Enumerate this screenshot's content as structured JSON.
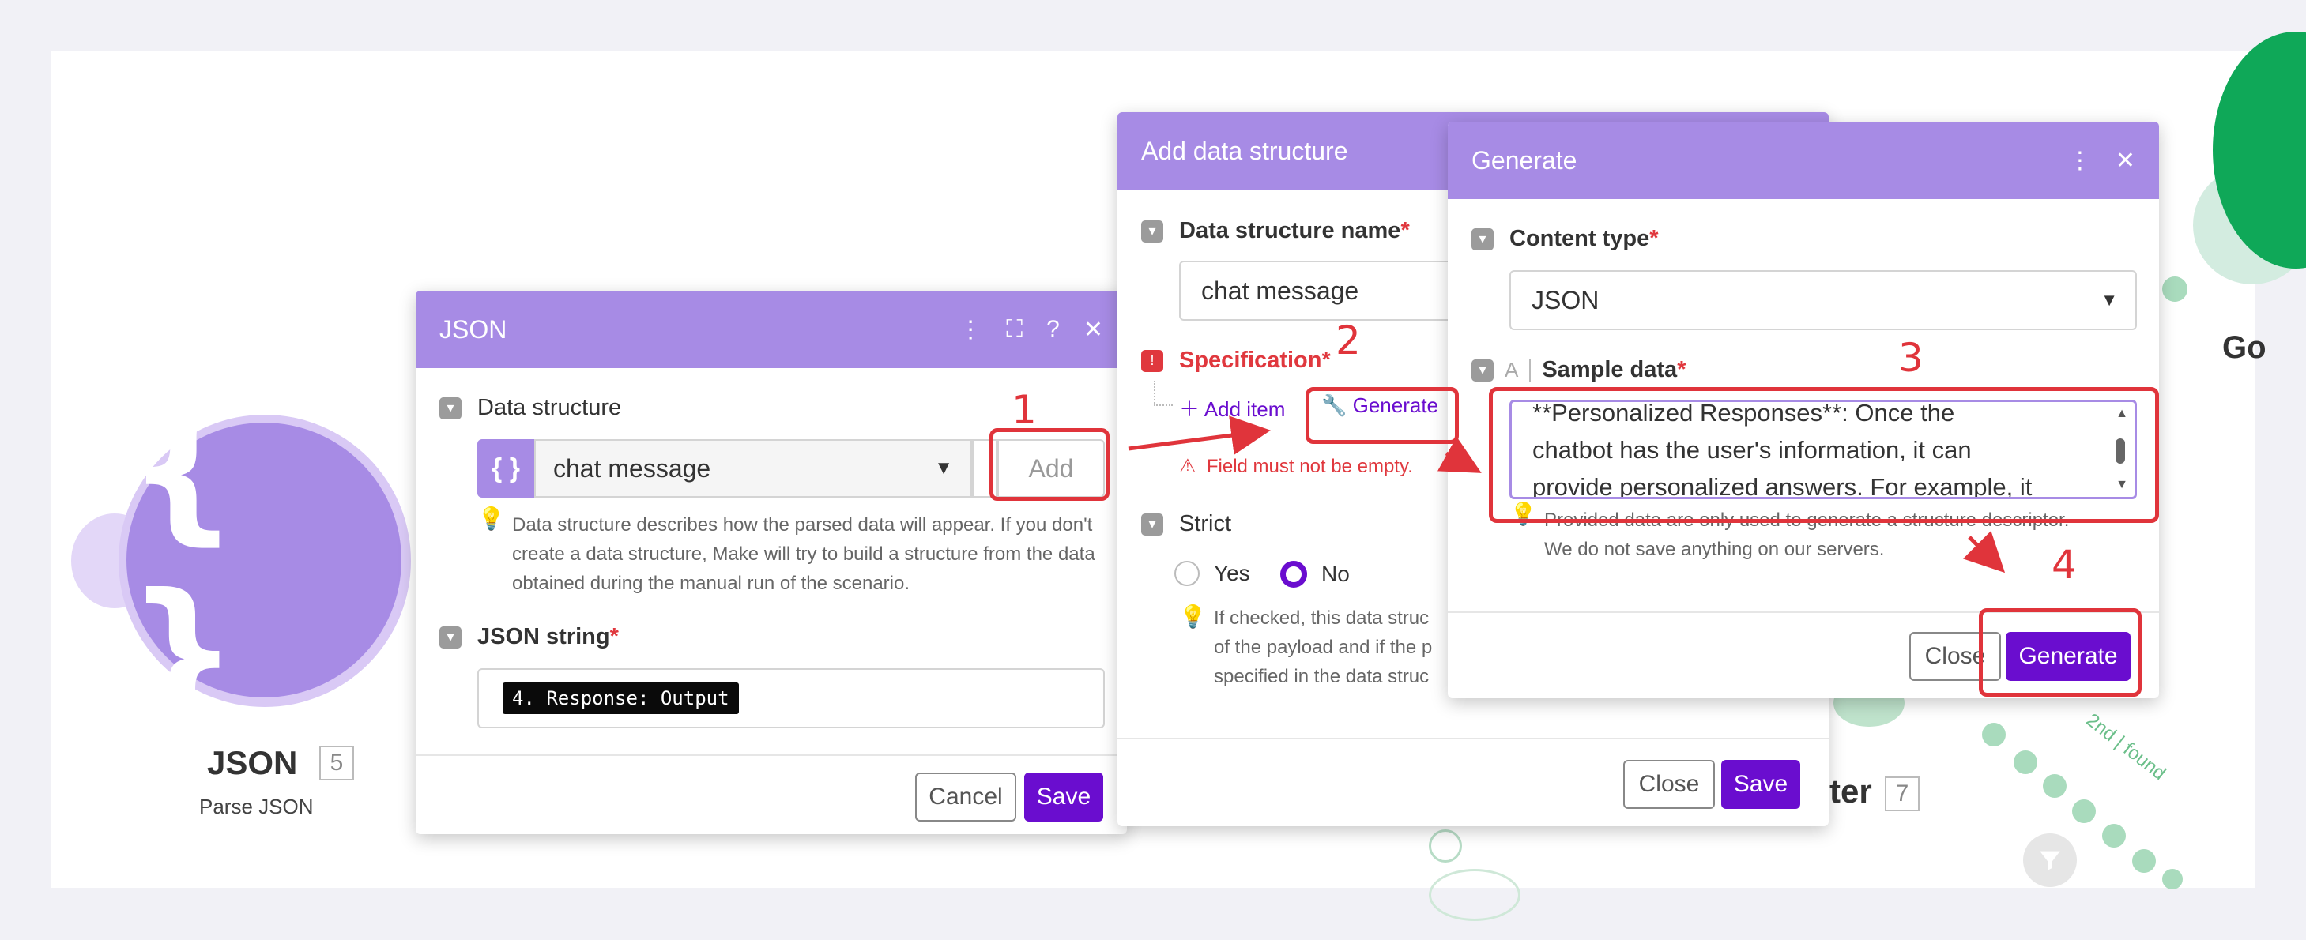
{
  "module": {
    "title": "JSON",
    "badge": "5",
    "subtitle": "Parse JSON",
    "glyph": "{ }",
    "color": "#a78be5"
  },
  "background": {
    "right_label": "Go",
    "filter_label": "ter",
    "filter_badge": "7",
    "route_label_1": "2nd",
    "route_label_2": "found",
    "accent": "#0fa858"
  },
  "json_panel": {
    "title": "JSON",
    "data_structure_label": "Data structure",
    "data_structure_value": "chat message",
    "add_button": "Add",
    "help_text": "Data structure describes how the parsed data will appear. If you don't create a data structure, Make will try to build a structure from the data obtained during the manual run of the scenario.",
    "json_string_label": "JSON string",
    "json_string_chip": "4. Response: Output",
    "cancel_button": "Cancel",
    "save_button": "Save"
  },
  "add_panel": {
    "title": "Add data structure",
    "name_label": "Data structure name",
    "name_value": "chat message",
    "spec_label": "Specification",
    "add_item": "Add item",
    "generate_link": "Generate",
    "error_text": "Field must not be empty.",
    "strict_label": "Strict",
    "yes_label": "Yes",
    "no_label": "No",
    "selected": "No",
    "help_line_1": "If checked, this data struc",
    "help_line_2": "of the payload and if the p",
    "help_line_3": "specified in the data struc",
    "close_button": "Close",
    "save_button": "Save"
  },
  "generate_panel": {
    "title": "Generate",
    "content_type_label": "Content type",
    "content_type_value": "JSON",
    "sample_label": "Sample data",
    "sample_line_1": "**Personalized Responses**: Once the",
    "sample_line_2": "chatbot has the user's information, it can",
    "sample_line_3": "provide personalized answers. For example, it",
    "note_line_1": "Provided data are only used to generate a structure descriptor.",
    "note_line_2": "We do not save anything on our servers.",
    "close_button": "Close",
    "generate_button": "Generate"
  },
  "annotations": {
    "n1": "1",
    "n2": "2",
    "n3": "3",
    "n4": "4",
    "color": "#e0343b"
  },
  "colors": {
    "header": "#a78be5",
    "primary": "#6a0dcf",
    "error": "#e0383e"
  }
}
